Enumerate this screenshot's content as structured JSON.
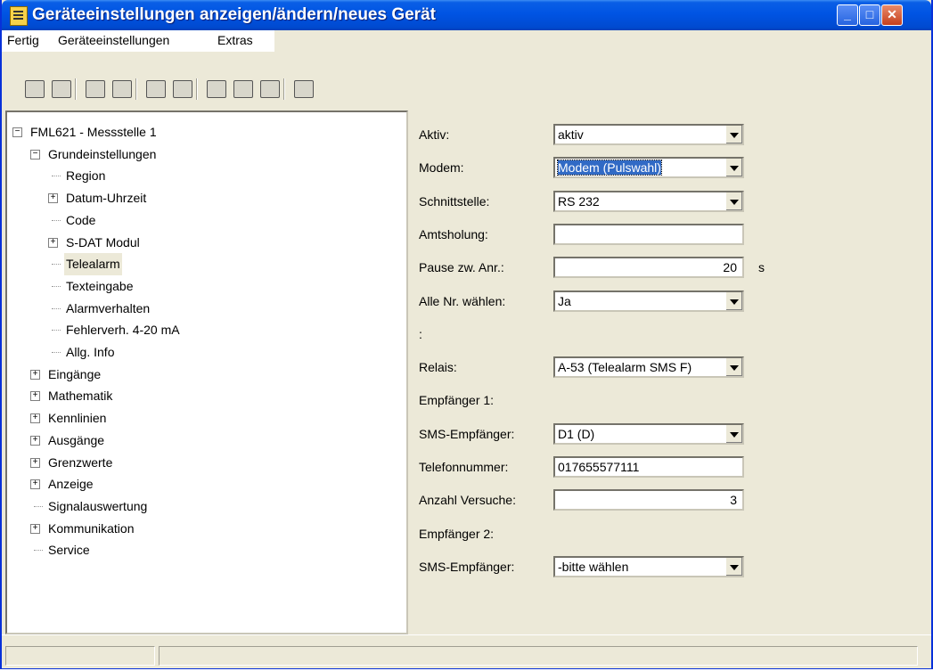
{
  "window": {
    "title": "Geräteeinstellungen anzeigen/ändern/neues Gerät"
  },
  "menu": [
    "Fertig",
    "Geräteeinstellungen",
    "Extras"
  ],
  "toolbar_icons": [
    "save-icon",
    "device-icon",
    "read-icon",
    "print-icon",
    "transfer-icon",
    "connect-icon",
    "properties-icon",
    "network-icon",
    "settings-icon",
    "tree-icon"
  ],
  "tree": [
    {
      "label": "FML621 - Messstelle 1",
      "level": 0,
      "expander": "minus"
    },
    {
      "label": "Grundeinstellungen",
      "level": 1,
      "expander": "minus"
    },
    {
      "label": "Region",
      "level": 2,
      "expander": ""
    },
    {
      "label": "Datum-Uhrzeit",
      "level": 2,
      "expander": "plus"
    },
    {
      "label": "Code",
      "level": 2,
      "expander": ""
    },
    {
      "label": "S-DAT Modul",
      "level": 2,
      "expander": "plus"
    },
    {
      "label": "Telealarm",
      "level": 2,
      "expander": "",
      "selected": true
    },
    {
      "label": "Texteingabe",
      "level": 2,
      "expander": ""
    },
    {
      "label": "Alarmverhalten",
      "level": 2,
      "expander": ""
    },
    {
      "label": "Fehlerverh. 4-20 mA",
      "level": 2,
      "expander": ""
    },
    {
      "label": "Allg. Info",
      "level": 2,
      "expander": ""
    },
    {
      "label": "Eingänge",
      "level": 1,
      "expander": "plus"
    },
    {
      "label": "Mathematik",
      "level": 1,
      "expander": "plus"
    },
    {
      "label": "Kennlinien",
      "level": 1,
      "expander": "plus"
    },
    {
      "label": "Ausgänge",
      "level": 1,
      "expander": "plus"
    },
    {
      "label": "Grenzwerte",
      "level": 1,
      "expander": "plus"
    },
    {
      "label": "Anzeige",
      "level": 1,
      "expander": "plus"
    },
    {
      "label": "Signalauswertung",
      "level": 1,
      "expander": ""
    },
    {
      "label": "Kommunikation",
      "level": 1,
      "expander": "plus"
    },
    {
      "label": "Service",
      "level": 1,
      "expander": ""
    }
  ],
  "form": [
    {
      "label": "Aktiv:",
      "value": "aktiv",
      "type": "dropdown"
    },
    {
      "label": "Modem:",
      "value": "Modem (Pulswahl)",
      "type": "dropdown",
      "focused": true
    },
    {
      "label": "Schnittstelle:",
      "value": "RS 232",
      "type": "dropdown"
    },
    {
      "label": "Amtsholung:",
      "value": "",
      "type": "text"
    },
    {
      "label": "Pause zw. Anr.:",
      "value": "20",
      "type": "number",
      "unit": "s"
    },
    {
      "label": "Alle Nr. wählen:",
      "value": "Ja",
      "type": "dropdown"
    },
    {
      "label": ":",
      "value": "",
      "type": "none"
    },
    {
      "label": "Relais:",
      "value": "A-53  (Telealarm SMS F)",
      "type": "dropdown"
    },
    {
      "label": "Empfänger 1:",
      "value": "",
      "type": "none"
    },
    {
      "label": "SMS-Empfänger:",
      "value": "D1 (D)",
      "type": "dropdown"
    },
    {
      "label": "Telefonnummer:",
      "value": "017655577111",
      "type": "text"
    },
    {
      "label": "Anzahl Versuche:",
      "value": "3",
      "type": "number"
    },
    {
      "label": "Empfänger 2:",
      "value": "",
      "type": "none"
    },
    {
      "label": "SMS-Empfänger:",
      "value": "-bitte wählen",
      "type": "dropdown"
    }
  ]
}
